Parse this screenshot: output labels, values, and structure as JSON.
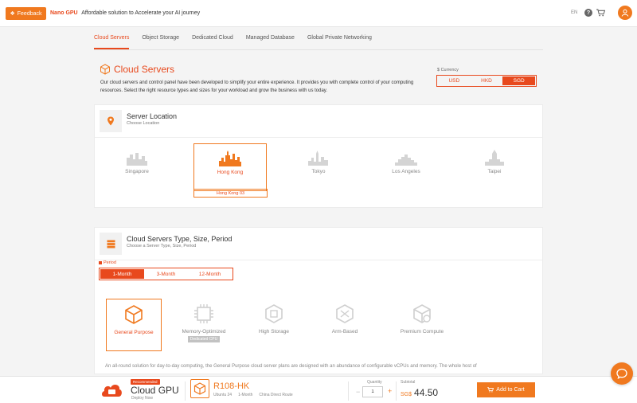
{
  "topbar": {
    "feedback_label": "Feedback",
    "brand_name": "Nano GPU",
    "brand_tagline": "Affordable solution to Accelerate your AI journey",
    "language": "EN"
  },
  "tabs": [
    {
      "label": "Cloud Servers",
      "active": true
    },
    {
      "label": "Object Storage",
      "active": false
    },
    {
      "label": "Dedicated Cloud",
      "active": false
    },
    {
      "label": "Managed Database",
      "active": false
    },
    {
      "label": "Global Private Networking",
      "active": false
    }
  ],
  "page": {
    "title": "Cloud Servers",
    "description": "Our cloud servers and control panel have been developed to simplify your entire experience. It provides you with complete control of your computing resources. Select the right resource types and sizes for your workload and grow the business with us today."
  },
  "currency": {
    "label": "$ Currency",
    "options": [
      "USD",
      "HKD",
      "SGD"
    ],
    "selected": "SGD"
  },
  "location_section": {
    "title": "Server Location",
    "subtitle": "Choose Location",
    "locations": [
      "Singapore",
      "Hong Kong",
      "Tokyo",
      "Los Angeles",
      "Taipei"
    ],
    "selected": "Hong Kong",
    "datacenter": "Hong Kong 03"
  },
  "type_section": {
    "title": "Cloud Servers Type, Size, Period",
    "subtitle": "Choose a Server Type, Size, Period",
    "period_label": "Period",
    "periods": [
      "1-Month",
      "3-Month",
      "12-Month"
    ],
    "selected_period": "1-Month",
    "types": [
      {
        "name": "General Purpose",
        "badge": ""
      },
      {
        "name": "Memory-Optimized",
        "badge": "Dedicated CPU"
      },
      {
        "name": "High Storage",
        "badge": ""
      },
      {
        "name": "Arm-Based",
        "badge": ""
      },
      {
        "name": "Premium Compute",
        "badge": ""
      }
    ],
    "selected_type": "General Purpose",
    "description": "An all-round solution for day-to-day computing, the General Purpose cloud server plans are designed with an abundance of configurable vCPUs and memory. The whole host of"
  },
  "bottombar": {
    "recommended_tag": "Recommended",
    "product_name": "Cloud GPU",
    "deploy_text": "Deploy Now",
    "plan_name": "R108-HK",
    "plan_os": "Ubuntu 24",
    "plan_period": "1-Month",
    "plan_route": "China Direct Route",
    "quantity_label": "Quantity",
    "quantity": "1",
    "subtotal_label": "Subtotal",
    "subtotal_currency": "SG$",
    "subtotal_amount": "44.50",
    "add_to_cart_label": "Add to Cart"
  },
  "colors": {
    "accent": "#e8491d",
    "accent_light": "#f0791f",
    "muted_icon": "#c8c8c8"
  }
}
